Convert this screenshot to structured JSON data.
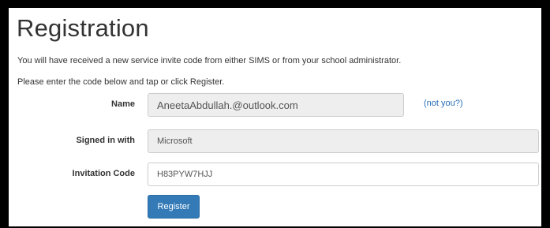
{
  "page": {
    "title": "Registration",
    "intro_line1": "You will have received a new service invite code from either SIMS or from your school administrator.",
    "intro_line2": "Please enter the code below and tap or click Register."
  },
  "form": {
    "name_label": "Name",
    "name_value": "AneetaAbdullah.@outlook.com",
    "not_you_link": "(not you?)",
    "signed_in_label": "Signed in with",
    "signed_in_value": "Microsoft",
    "invitation_label": "Invitation Code",
    "invitation_value": "H83PYW7HJJ",
    "register_label": "Register"
  },
  "colors": {
    "accent": "#337ab7",
    "link": "#2a6fb6",
    "readonly_bg": "#eeeeee"
  }
}
